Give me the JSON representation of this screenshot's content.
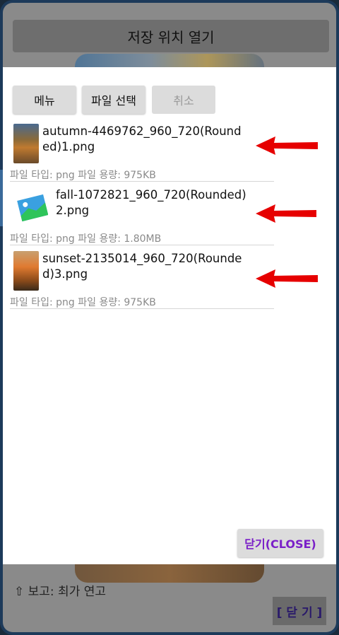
{
  "background": {
    "title": "저장 위치 열기",
    "notice": "⇧ 보고: 최가 연고",
    "close_label": "[ 닫 기 ]"
  },
  "dialog": {
    "buttons": {
      "menu": "메뉴",
      "select_file": "파일 선택",
      "cancel": "취소"
    },
    "files": [
      {
        "name": "autumn-4469762_960_720(Rounded)1.png",
        "meta": "파일 타입: png 파일 용량: 975KB",
        "thumb": "autumn-photo"
      },
      {
        "name": "fall-1072821_960_720(Rounded)2.png",
        "meta": "파일 타입: png 파일 용량: 1.80MB",
        "thumb": "image-placeholder-icon"
      },
      {
        "name": "sunset-2135014_960_720(Rounded)3.png",
        "meta": "파일 타입: png 파일 용량: 975KB",
        "thumb": "sunset-photo"
      }
    ],
    "close_label": "닫기(CLOSE)",
    "annotation_color": "#e60000",
    "close_text_color": "#7a1fc8"
  }
}
